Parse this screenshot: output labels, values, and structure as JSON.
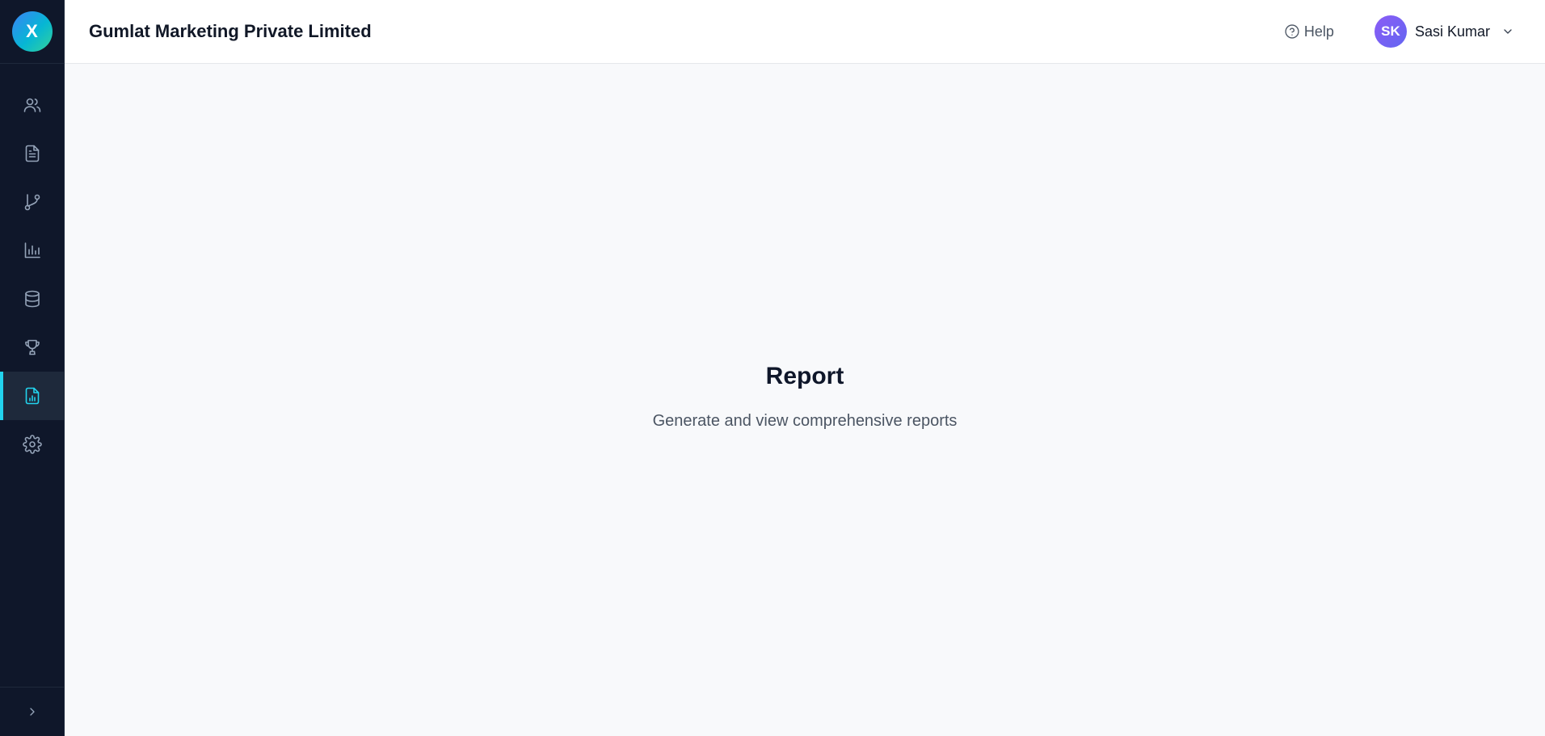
{
  "app": {
    "logo_text": "X",
    "company_name": "Gumlat Marketing Private Limited"
  },
  "header": {
    "help_label": "Help",
    "user": {
      "initials": "SK",
      "name": "Sasi Kumar"
    }
  },
  "sidebar": {
    "items": [
      {
        "icon": "users-icon",
        "active": false
      },
      {
        "icon": "document-icon",
        "active": false
      },
      {
        "icon": "git-branch-icon",
        "active": false
      },
      {
        "icon": "bar-chart-icon",
        "active": false
      },
      {
        "icon": "database-icon",
        "active": false
      },
      {
        "icon": "trophy-icon",
        "active": false
      },
      {
        "icon": "report-icon",
        "active": true
      },
      {
        "icon": "gear-icon",
        "active": false
      }
    ],
    "collapse_icon": "chevron-right-icon"
  },
  "main": {
    "title": "Report",
    "subtitle": "Generate and view comprehensive reports"
  },
  "colors": {
    "sidebar_bg": "#0f172a",
    "accent": "#22d3ee",
    "avatar": "#6366f1"
  }
}
